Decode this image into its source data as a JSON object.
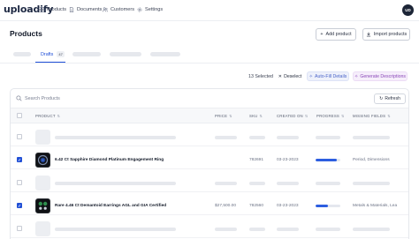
{
  "app": {
    "logo": "uploadify",
    "nav": [
      {
        "label": "Products",
        "icon": "grid-icon"
      },
      {
        "label": "Documents",
        "icon": "document-icon"
      },
      {
        "label": "Customers",
        "icon": "users-icon"
      },
      {
        "label": "Settings",
        "icon": "gear-icon"
      }
    ],
    "user_initials": "UD"
  },
  "header": {
    "title": "Products",
    "add_label": "Add product",
    "import_label": "Import products"
  },
  "tabs": {
    "active_label": "Drafts",
    "active_count": "47"
  },
  "selection": {
    "count_text": "13 Selected",
    "deselect_label": "Deselect",
    "autofill_label": "Auto-Fill Details",
    "generate_label": "Generate Descriptions"
  },
  "table": {
    "search_placeholder": "Search Products",
    "refresh_label": "Refresh",
    "columns": [
      "PRODUCT",
      "PRICE",
      "SKU",
      "CREATED ON",
      "PROGRESS",
      "MISSING FIELDS"
    ],
    "rows": [
      {
        "type": "skeleton"
      },
      {
        "type": "filled",
        "checked": true,
        "name": "6.42 Ct Sapphire Diamond Platinum Engagement Ring",
        "price": "",
        "sku": "782691",
        "created": "03-23-2023",
        "progress": 0.85,
        "missing": "Period, Dimensions"
      },
      {
        "type": "skeleton"
      },
      {
        "type": "filled",
        "checked": true,
        "name": "Rare 4.46 Ct Demantoid Earrings AGL and GIA Certified",
        "price": "$27,500.00",
        "sku": "782560",
        "created": "03-23-2023",
        "progress": 0.5,
        "missing": "Metals & Materials, Lea"
      },
      {
        "type": "skeleton"
      }
    ]
  },
  "colors": {
    "accent": "#2250d6",
    "autofill": "#4a64c8",
    "generate": "#8a47b8"
  }
}
